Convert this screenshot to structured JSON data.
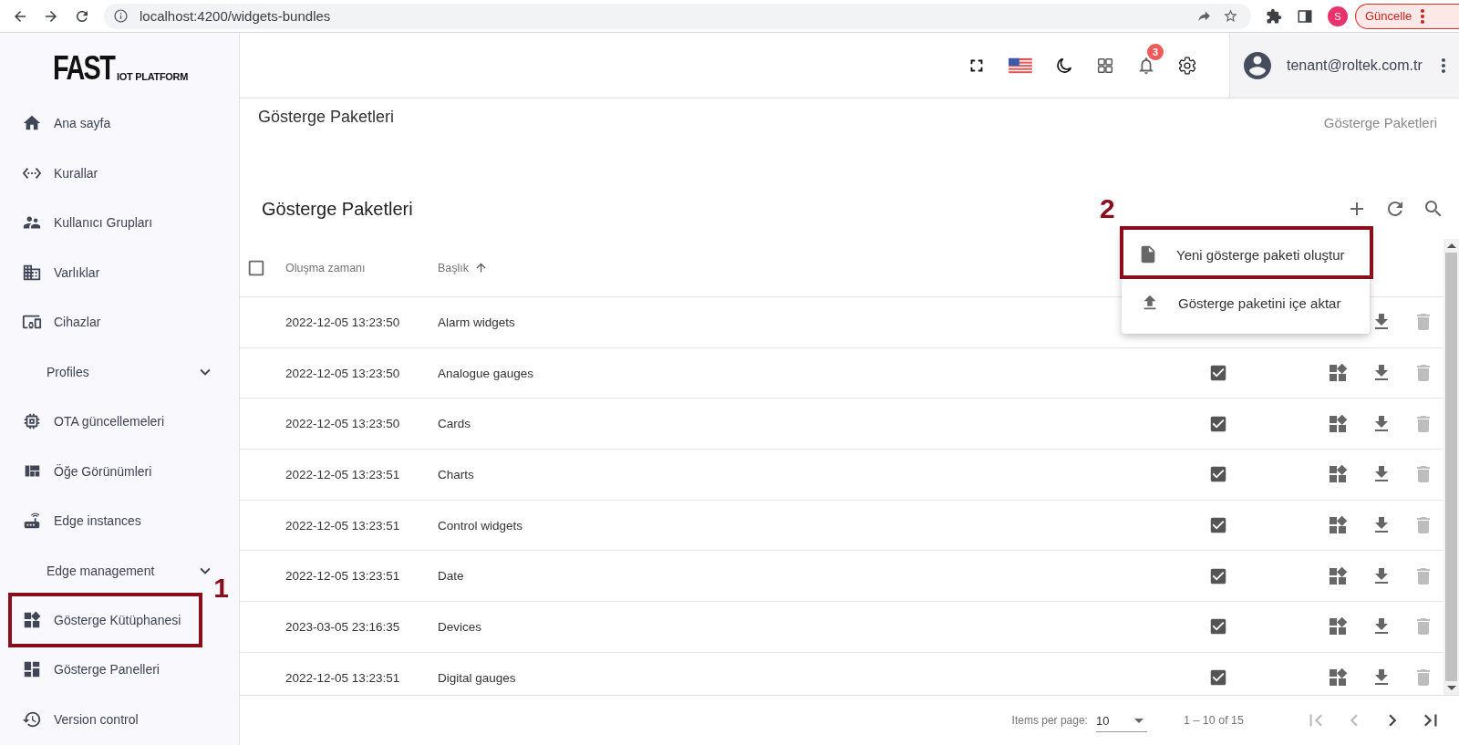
{
  "browser": {
    "url": "localhost:4200/widgets-bundles",
    "profile_initial": "S",
    "update_button": "Güncelle"
  },
  "logo": {
    "main": "FAST",
    "sub": "IOT PLATFORM"
  },
  "sidebar": {
    "items": [
      {
        "kind": "link",
        "label": "Ana sayfa"
      },
      {
        "kind": "link",
        "label": "Kurallar"
      },
      {
        "kind": "link",
        "label": "Kullanıcı Grupları"
      },
      {
        "kind": "link",
        "label": "Varlıklar"
      },
      {
        "kind": "link",
        "label": "Cihazlar"
      },
      {
        "kind": "section",
        "label": "Profiles",
        "expanded": false
      },
      {
        "kind": "link",
        "label": "OTA güncellemeleri"
      },
      {
        "kind": "link",
        "label": "Öğe Görünümleri"
      },
      {
        "kind": "link",
        "label": "Edge instances"
      },
      {
        "kind": "section",
        "label": "Edge management",
        "expanded": false
      },
      {
        "kind": "link",
        "label": "Gösterge Kütüphanesi",
        "annotation": "1"
      },
      {
        "kind": "link",
        "label": "Gösterge Panelleri"
      },
      {
        "kind": "link",
        "label": "Version control"
      }
    ]
  },
  "header": {
    "notification_count": "3",
    "user_email": "tenant@roltek.com.tr"
  },
  "page": {
    "title": "Gösterge Paketleri",
    "breadcrumb": "Gösterge Paketleri"
  },
  "card": {
    "title": "Gösterge Paketleri"
  },
  "table": {
    "select_all": {
      "checked": false
    },
    "columns": [
      {
        "label": "Oluşma zamanı"
      },
      {
        "label": "Başlık",
        "sorted_ascending": true
      }
    ],
    "rows": [
      {
        "created": "2022-12-05 13:23:50",
        "title": "Alarm widgets"
      },
      {
        "created": "2022-12-05 13:23:50",
        "title": "Analogue gauges",
        "system": true
      },
      {
        "created": "2022-12-05 13:23:50",
        "title": "Cards",
        "system": true
      },
      {
        "created": "2022-12-05 13:23:51",
        "title": "Charts",
        "system": true
      },
      {
        "created": "2022-12-05 13:23:51",
        "title": "Control widgets",
        "system": true
      },
      {
        "created": "2022-12-05 13:23:51",
        "title": "Date",
        "system": true
      },
      {
        "created": "2023-03-05 23:16:35",
        "title": "Devices",
        "system": true
      },
      {
        "created": "2022-12-05 13:23:51",
        "title": "Digital gauges",
        "system": true
      }
    ]
  },
  "menu": {
    "items": [
      {
        "kind": "create",
        "label": "Yeni gösterge paketi oluştur",
        "annotation": "2"
      },
      {
        "kind": "import",
        "label": "Gösterge paketini içe aktar"
      }
    ]
  },
  "pagination": {
    "label": "Items per page:",
    "page_size": "10",
    "range": "1 – 10 of 15",
    "first_disabled": true,
    "prev_disabled": true,
    "next_disabled": false,
    "last_disabled": false
  }
}
